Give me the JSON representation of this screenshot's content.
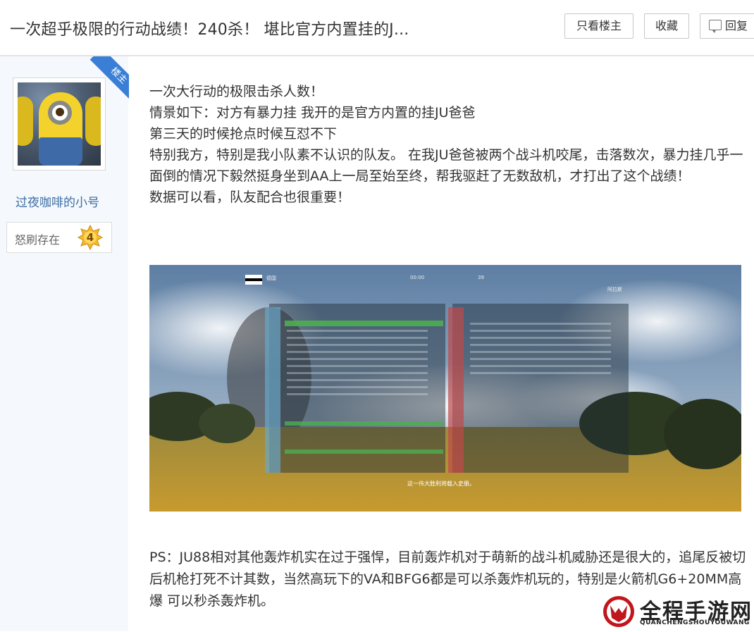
{
  "header": {
    "title": "一次超乎极限的行动战绩！240杀！ 堪比官方内置挂的J...",
    "buttons": {
      "only_op": "只看楼主",
      "favorite": "收藏",
      "reply": "回复"
    }
  },
  "author": {
    "ribbon_label": "楼主",
    "username": "过夜咖啡的小号",
    "level_title": "怒刷存在",
    "level_number": "4",
    "avatar_icon": "minion-avatar"
  },
  "post": {
    "lines": [
      "一次大行动的极限击杀人数！",
      "情景如下：对方有暴力挂 我开的是官方内置的挂JU爸爸",
      "第三天的时候抢点时候互怼不下",
      "特别我方，特别是我小队素不认识的队友。 在我JU爸爸被两个战斗机咬尾，击落数次，暴力挂几乎一面倒的情况下毅然挺身坐到AA上一局至始至终，帮我驱赶了无数敌机，才打出了这个战绩！",
      "数据可以看，队友配合也很重要！"
    ],
    "screenshot": {
      "caption": "这一伟大胜利将载入史册。",
      "timer": "00:00",
      "players": "39",
      "team_left": "德国",
      "team_right": "阿拉斯"
    },
    "ps_text": "PS：JU88相对其他轰炸机实在过于强悍，目前轰炸机对于萌新的战斗机威胁还是很大的，追尾反被切后机枪打死不计其数，当然高玩下的VA和BFG6都是可以杀轰炸机玩的，特别是火箭机G6+20MM高爆 可以秒杀轰炸机。"
  },
  "watermark": {
    "brand": "全程手游网",
    "sub": "QUANCHENGSHOUYOUWANG"
  },
  "colors": {
    "accent_blue": "#3a7fd5",
    "username_blue": "#3a6ea5",
    "sidebar_bg": "#f5f8fc"
  }
}
